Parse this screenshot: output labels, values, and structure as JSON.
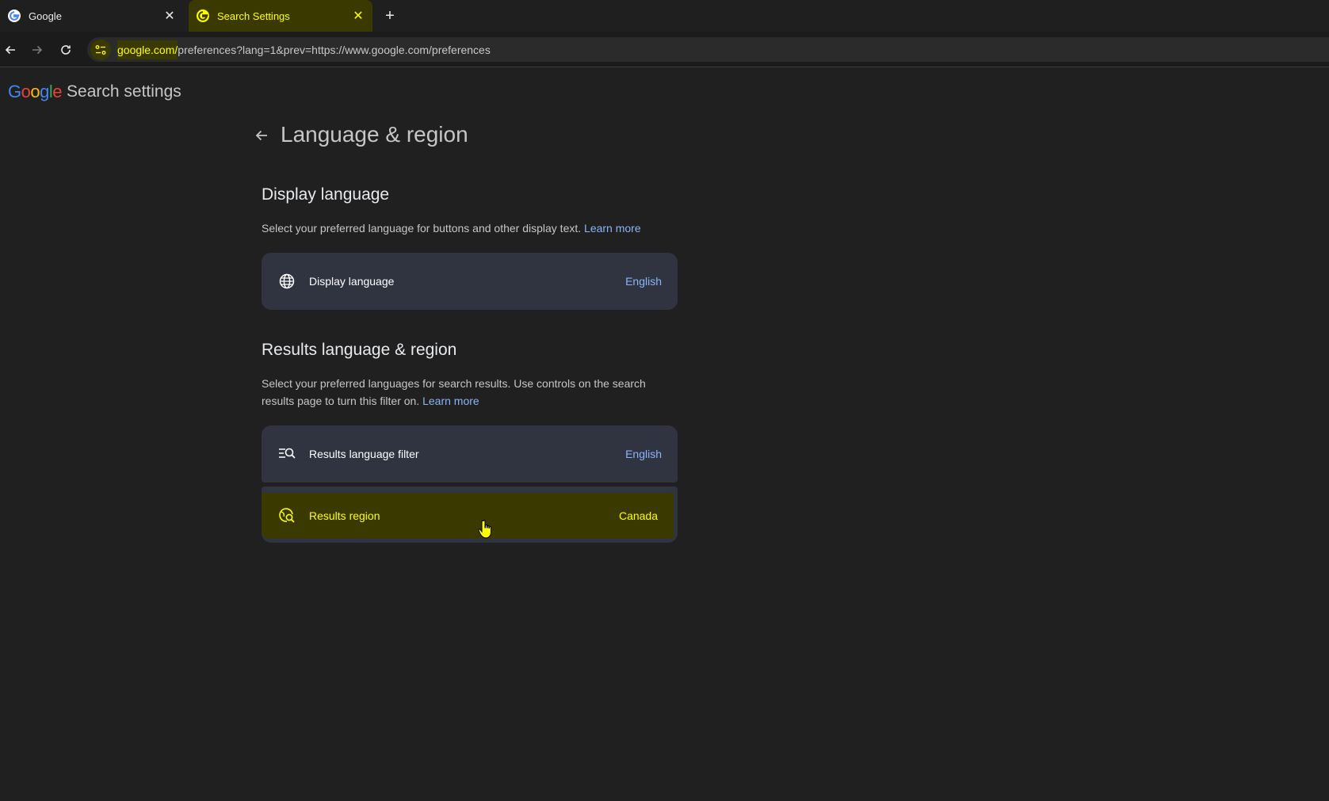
{
  "browser": {
    "tabs": [
      {
        "label": "Google",
        "icon": "google-favicon"
      },
      {
        "label": "Search Settings",
        "icon": "google-favicon",
        "active": true
      }
    ],
    "new_tab_icon": "plus-icon",
    "url_host": "google.com/",
    "url_path": "preferences?lang=1&prev=https://www.google.com/preferences"
  },
  "header": {
    "logo_letters": [
      "G",
      "o",
      "o",
      "g",
      "l",
      "e"
    ],
    "title": "Search settings"
  },
  "page": {
    "title": "Language & region"
  },
  "display_section": {
    "title": "Display language",
    "description": "Select your preferred language for buttons and other display text.",
    "learn_more": "Learn more",
    "card": {
      "label": "Display language",
      "value": "English",
      "icon": "globe-icon"
    }
  },
  "results_section": {
    "title": "Results language & region",
    "description": "Select your preferred languages for search results. Use controls on the search results page to turn this filter on.",
    "learn_more": "Learn more",
    "filter_card": {
      "label": "Results language filter",
      "value": "English",
      "icon": "filter-search-icon"
    },
    "region_card": {
      "label": "Results region",
      "value": "Canada",
      "icon": "region-search-icon"
    }
  },
  "colors": {
    "background": "#202020",
    "card": "#303441",
    "link": "#8ab4f8",
    "highlight_bg": "#3a3a00",
    "highlight_fg": "#ffff00"
  }
}
